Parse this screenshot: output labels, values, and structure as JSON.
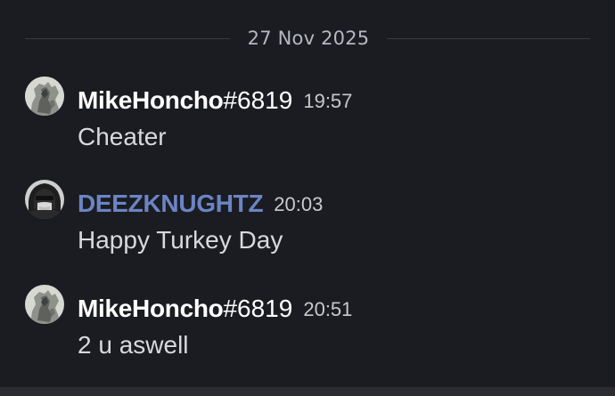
{
  "date_divider": {
    "label": "27 Nov 2025"
  },
  "messages": [
    {
      "username": "MikeHoncho",
      "discriminator": "#6819",
      "timestamp": "19:57",
      "content": "Cheater",
      "avatar_icon": "statue-avatar-icon"
    },
    {
      "username": "DEEZKNUGHTZ",
      "discriminator": "",
      "timestamp": "20:03",
      "content": "Happy Turkey Day",
      "avatar_icon": "hooded-face-avatar-icon",
      "username_color": "#6b84c4"
    },
    {
      "username": "MikeHoncho",
      "discriminator": "#6819",
      "timestamp": "20:51",
      "content": "2 u aswell",
      "avatar_icon": "statue-avatar-icon"
    }
  ],
  "colors": {
    "background": "#1b1c21",
    "divider_line": "#3a3c43",
    "username_default": "#ffffff",
    "username_accent": "#6b84c4",
    "message_text": "#d7d9dc"
  }
}
